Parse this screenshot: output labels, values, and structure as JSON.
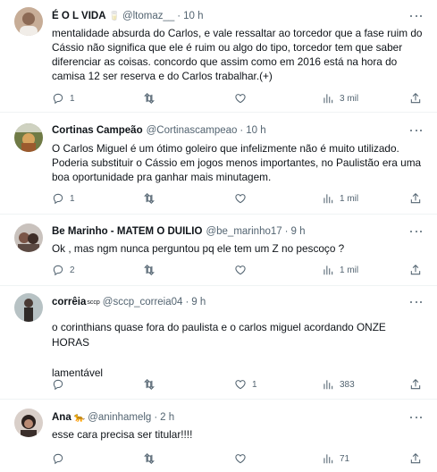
{
  "tweets": [
    {
      "name": "É O L VIDA",
      "emoji": "🥛",
      "handle": "@ltomaz__",
      "sep": "·",
      "time": "10 h",
      "text": "mentalidade absurda do Carlos, e vale ressaltar ao torcedor que a fase ruim do Cássio não significa que ele é ruim ou algo do tipo, torcedor tem que saber diferenciar as coisas. concordo que assim como em 2016 está na hora do camisa 12 ser reserva e do Carlos trabalhar.(+)",
      "replies": "1",
      "retweets": "",
      "likes": "",
      "views": "3 mil",
      "avatar_color": "#b99c88"
    },
    {
      "name": "Cortinas Campeão",
      "emoji": "",
      "handle": "@Cortinascampeao",
      "sep": "·",
      "time": "10 h",
      "text": "O Carlos Miguel é um ótimo goleiro que infelizmente não é muito utilizado. Poderia substituir o Cássio em jogos menos importantes, no Paulistão era uma boa oportunidade pra ganhar mais minutagem.",
      "replies": "1",
      "retweets": "",
      "likes": "",
      "views": "1 mil",
      "avatar_color": "#7d8a52"
    },
    {
      "name": "Be Marinho - MATEM O DUILIO",
      "emoji": "",
      "handle": "@be_marinho17",
      "sep": "·",
      "time": "9 h",
      "text": "Ok , mas ngm nunca perguntou pq ele tem um Z no pescoço ?",
      "replies": "2",
      "retweets": "",
      "likes": "",
      "views": "1 mil",
      "avatar_color": "#8b6f63"
    },
    {
      "name": "corrêia",
      "superscript": "sccp",
      "emoji": "",
      "handle": "@sccp_correia04",
      "sep": "·",
      "time": "9 h",
      "text": "o corinthians quase fora do paulista e o carlos miguel acordando ONZE HORAS\n\nlamentável",
      "replies": "",
      "retweets": "",
      "likes": "1",
      "views": "383",
      "avatar_color": "#9aa6a8"
    },
    {
      "name": "Ana",
      "emoji": "🐆",
      "handle": "@aninhamelg",
      "sep": "·",
      "time": "2 h",
      "text": "esse cara precisa ser titular!!!!",
      "replies": "",
      "retweets": "",
      "likes": "",
      "views": "71",
      "avatar_color": "#5b4a44"
    }
  ]
}
